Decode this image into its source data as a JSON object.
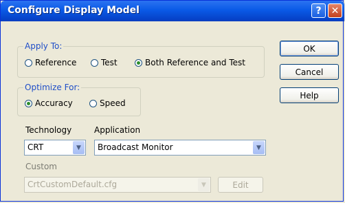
{
  "window": {
    "title": "Configure Display Model",
    "help_glyph": "?",
    "close_glyph": "✕"
  },
  "apply_to": {
    "legend": "Apply To:",
    "options": [
      "Reference",
      "Test",
      "Both Reference and Test"
    ],
    "selected": "Both Reference and Test"
  },
  "optimize_for": {
    "legend": "Optimize For:",
    "options": [
      "Accuracy",
      "Speed"
    ],
    "selected": "Accuracy"
  },
  "technology": {
    "label": "Technology",
    "value": "CRT"
  },
  "application": {
    "label": "Application",
    "value": "Broadcast Monitor"
  },
  "custom": {
    "label": "Custom",
    "value": "CrtCustomDefault.cfg",
    "edit_label": "Edit"
  },
  "buttons": {
    "ok": "OK",
    "cancel": "Cancel",
    "help": "Help"
  }
}
